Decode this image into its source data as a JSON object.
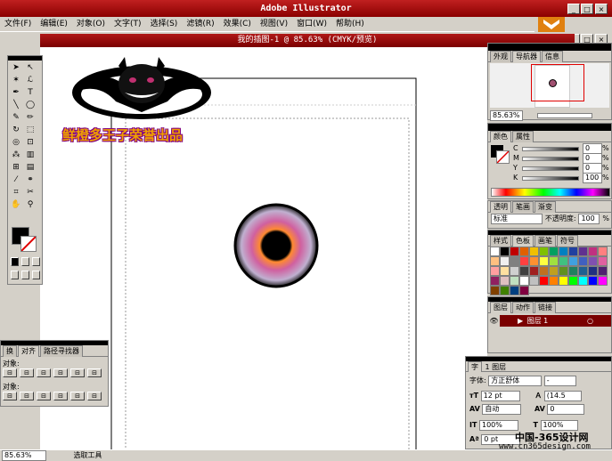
{
  "app": {
    "title": "Adobe Illustrator"
  },
  "menu": [
    "文件(F)",
    "编辑(E)",
    "对象(O)",
    "文字(T)",
    "选择(S)",
    "滤镜(R)",
    "效果(C)",
    "视图(V)",
    "窗口(W)",
    "帮助(H)"
  ],
  "document": {
    "title": "我的插图-1 @ 85.63% (CMYK/预览)"
  },
  "logo": {
    "text": "鲜橙多王子荣誉出品"
  },
  "navigator": {
    "tabs": [
      "外观",
      "导航器",
      "信息"
    ],
    "zoom": "85.63%"
  },
  "color": {
    "tabs": [
      "颜色",
      "属性"
    ],
    "channels": [
      {
        "label": "C",
        "value": "0",
        "unit": "%"
      },
      {
        "label": "M",
        "value": "0",
        "unit": "%"
      },
      {
        "label": "Y",
        "value": "0",
        "unit": "%"
      },
      {
        "label": "K",
        "value": "100",
        "unit": "%"
      }
    ]
  },
  "transparency": {
    "tabs": [
      "透明",
      "笔画",
      "渐变"
    ],
    "mode": "标准",
    "opacity_label": "不透明度:",
    "opacity_value": "100",
    "opacity_unit": "%"
  },
  "swatches": {
    "tabs": [
      "样式",
      "色板",
      "画笔",
      "符号"
    ]
  },
  "layers": {
    "tabs": [
      "图层",
      "动作",
      "链接"
    ],
    "layer_name": "图层 1",
    "count": "1 图层"
  },
  "character": {
    "tab": "字",
    "font_label": "字体:",
    "font_value": "方正舒体",
    "font_style": "-",
    "size": "12 pt",
    "leading": "(14.5",
    "kerning": "自动",
    "tracking": "0",
    "vscale": "100%",
    "hscale": "100%",
    "baseline": "0 pt"
  },
  "align": {
    "tabs": [
      "换",
      "对齐",
      "路径寻找器"
    ],
    "row1_label": "对象:",
    "row2_label": "对象:"
  },
  "status": {
    "zoom": "85.63%",
    "tool": "选取工具"
  },
  "watermark": {
    "line1": "中国-365设计网",
    "line2": "www.cn365design.com"
  }
}
